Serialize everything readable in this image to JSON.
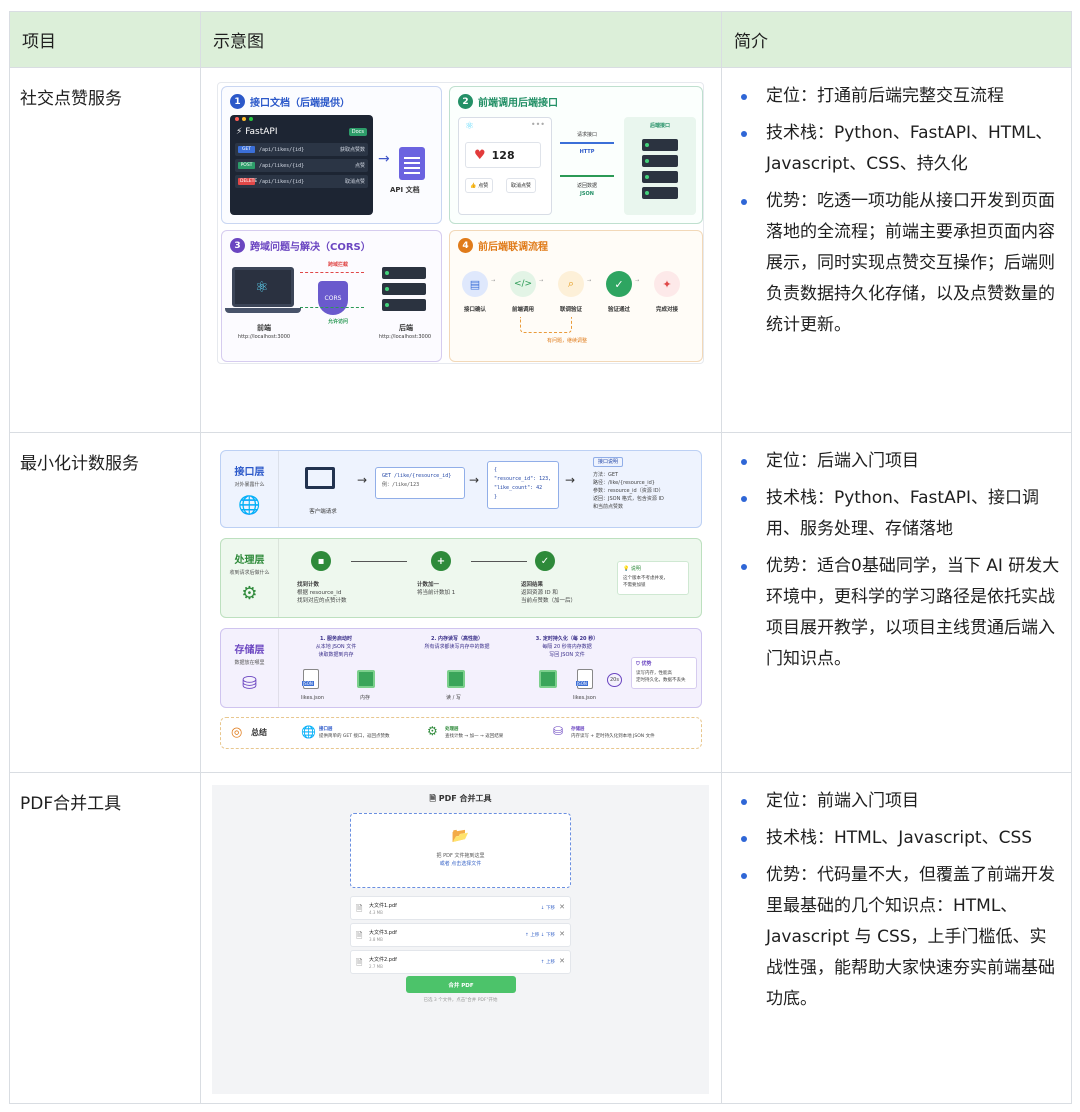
{
  "table": {
    "headers": [
      "项目",
      "示意图",
      "简介"
    ],
    "rows": [
      {
        "name": "社交点赞服务",
        "bullets": [
          "定位：打通前后端完整交互流程",
          "技术栈：Python、FastAPI、HTML、Javascript、CSS、持久化",
          "优势：吃透一项功能从接口开发到页面落地的全流程；前端主要承担页面内容展示，同时实现点赞交互操作；后端则负责数据持久化存储，以及点赞数量的统计更新。"
        ]
      },
      {
        "name": "最小化计数服务",
        "bullets": [
          "定位：后端入门项目",
          "技术栈：Python、FastAPI、接口调用、服务处理、存储落地",
          "优势：适合0基础同学，当下 AI 研发大环境中，更科学的学习路径是依托实战项目展开教学，以项目主线贯通后端入门知识点。"
        ]
      },
      {
        "name": "PDF合并工具",
        "bullets": [
          "定位：前端入门项目",
          "技术栈：HTML、Javascript、CSS",
          "优势：代码量不大，但覆盖了前端开发里最基础的几个知识点：HTML、Javascript 与 CSS，上手门槛低、实战性强，能帮助大家快速夯实前端基础功底。"
        ]
      }
    ]
  },
  "fig1": {
    "p1_title": "接口文档（后端提供）",
    "p2_title": "前端调用后端接口",
    "p3_title": "跨域问题与解决（CORS）",
    "p4_title": "前后端联调流程",
    "fastapi": "FastAPI",
    "docs": "Docs",
    "endpoints": [
      {
        "method": "GET",
        "path": "/api/likes/{id}",
        "desc": "获取点赞数",
        "color": "#3b6fd8"
      },
      {
        "method": "POST",
        "path": "/api/likes/{id}",
        "desc": "点赞",
        "color": "#2d9d6a"
      },
      {
        "method": "DELETE",
        "path": "/api/likes/{id}",
        "desc": "取消点赞",
        "color": "#e04848"
      }
    ],
    "api_doc": "API 文档",
    "like_count": "128",
    "like_btn": "点赞",
    "unlike_btn": "取消点赞",
    "req_label": "请求接口",
    "http": "HTTP",
    "resp_label": "返回数据",
    "json": "JSON",
    "backend_api": "后端接口",
    "cors_block": "跨域拦截",
    "cors": "CORS",
    "cors_allow": "允许访问",
    "frontend": "前端",
    "frontend_url": "http://localhost:3000",
    "backend": "后端",
    "backend_url": "http://localhost:3000",
    "flow": [
      "接口确认",
      "前端调用",
      "联调验证",
      "验证通过",
      "完成对接"
    ],
    "flow_loop": "有问题，继续调整"
  },
  "fig2": {
    "l1_title": "接口层",
    "l1_sub": "对外暴露什么",
    "client": "客户端请求",
    "req_line1": "GET /like/{resource_id}",
    "req_line2": "例：/like/123",
    "resp_lines": [
      "{",
      "\"resource_id\": 123,",
      "\"like_count\": 42",
      "}"
    ],
    "api_desc_title": "接口说明",
    "api_desc": [
      "方法：GET",
      "路径：/like/{resource_id}",
      "参数：resource_id（资源 ID）",
      "返回：JSON 格式，包含资源 ID",
      "和当前点赞数"
    ],
    "l2_title": "处理层",
    "l2_sub": "收到请求后做什么",
    "steps": [
      {
        "title": "找到计数",
        "sub1": "根据 resource_id",
        "sub2": "找到对应的点赞计数"
      },
      {
        "title": "计数加一",
        "sub1": "将当前计数加 1",
        "sub2": ""
      },
      {
        "title": "返回结果",
        "sub1": "返回资源 ID 和",
        "sub2": "当前点赞数（加一后）"
      }
    ],
    "note_title": "说明",
    "note": [
      "这个版本不考虑并发，",
      "不需要加锁"
    ],
    "l3_title": "存储层",
    "l3_sub": "数据放在哪里",
    "s1_title": "1. 服务启动时",
    "s1_sub": [
      "从本地 JSON 文件",
      "读取数据到内存"
    ],
    "s2_title": "2. 内存读写（高性能）",
    "s2_sub": [
      "所有请求都读写内存中的数据"
    ],
    "s3_title": "3. 定时持久化（每 20 秒）",
    "s3_sub": [
      "每隔 20 秒将内存数据",
      "写回 JSON 文件"
    ],
    "likes_json": "likes.json",
    "mem": "内存",
    "rw": "读 / 写",
    "s20": "20s",
    "adv_title": "优势",
    "adv": [
      "读写内存，性能高",
      "定时持久化，数据不丢失"
    ],
    "summary": "总结",
    "sum_items": [
      {
        "t": "接口层",
        "d": "提供简单的 GET 接口，返回点赞数"
      },
      {
        "t": "处理层",
        "d": "查找计数 → 加一 → 返回结果"
      },
      {
        "t": "存储层",
        "d": "内存读写 + 定时持久化到本地 JSON 文件"
      }
    ]
  },
  "fig3": {
    "title": "PDF 合并工具",
    "drop1": "把 PDF 文件拖到这里",
    "drop2": "或者 点击选择文件",
    "files": [
      {
        "name": "大文件1.pdf",
        "size": "4.3 MB",
        "ops": "↓ 下移"
      },
      {
        "name": "大文件3.pdf",
        "size": "3.8 MB",
        "ops": "↑ 上移 ↓ 下移"
      },
      {
        "name": "大文件2.pdf",
        "size": "2.7 MB",
        "ops": "↑ 上移"
      }
    ],
    "merge": "合并 PDF",
    "hint": "已选 3 个文件，点击\"合并 PDF\"开始"
  }
}
